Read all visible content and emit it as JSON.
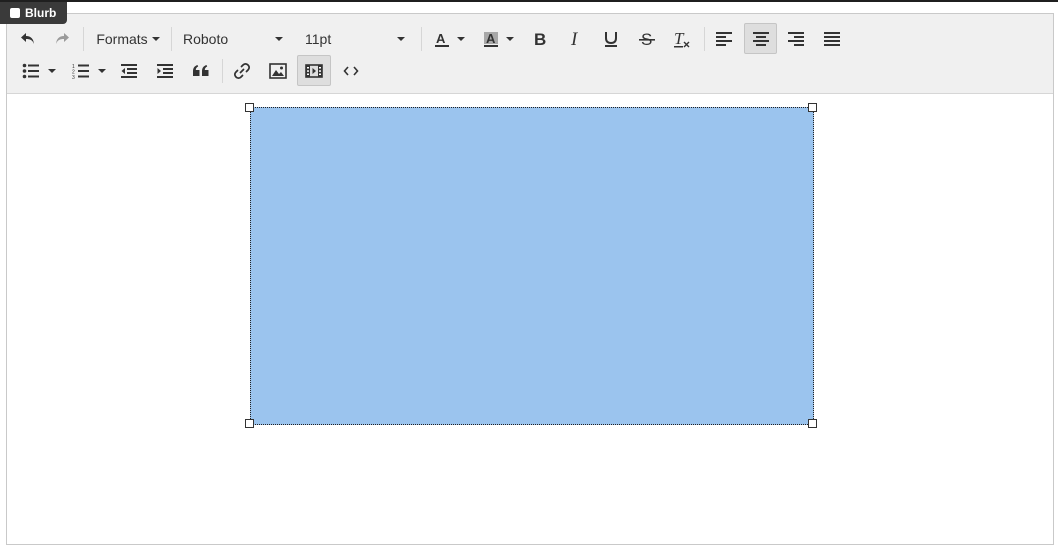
{
  "tag": {
    "label": "Blurb"
  },
  "toolbar": {
    "formats_label": "Formats",
    "font_family": "Roboto",
    "font_size": "11pt",
    "active_alignment": "align-center",
    "active_buttons": [
      "align-center",
      "insert-media"
    ]
  },
  "media": {
    "fill_color": "#9bc4ee",
    "selected": true
  }
}
